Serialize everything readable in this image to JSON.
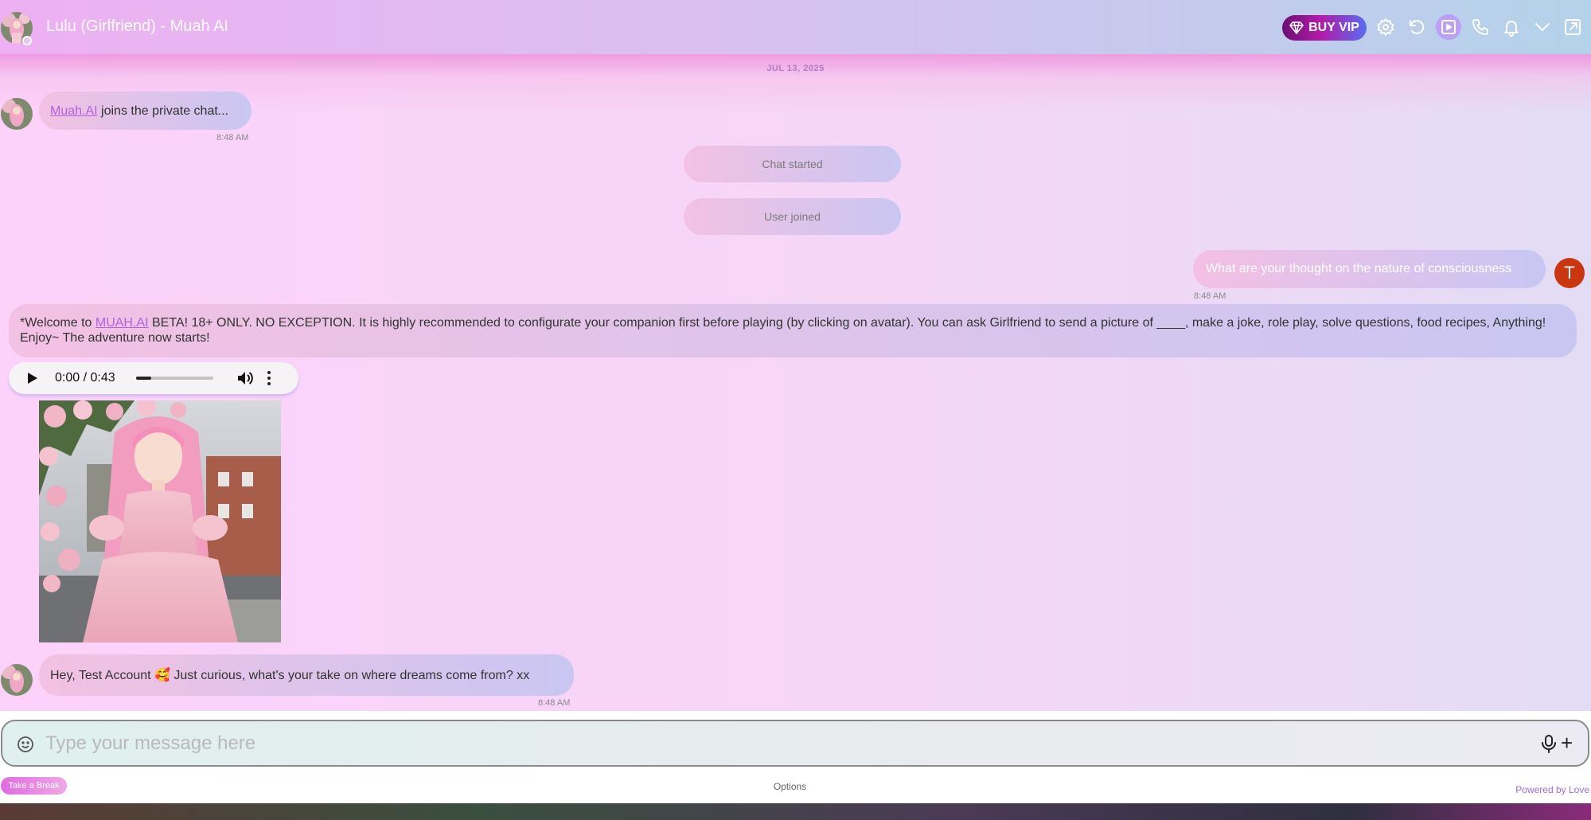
{
  "header": {
    "title": "Lulu (Girlfriend) - Muah AI",
    "vip_label": "BUY VIP",
    "icons": [
      "settings-icon",
      "refresh-icon",
      "video-icon",
      "phone-icon",
      "bell-icon",
      "chevron-down-icon",
      "external-link-icon"
    ]
  },
  "date_label": "JUL 13, 2025",
  "messages": {
    "join": {
      "link": "Muah.AI",
      "text": " joins the private chat...",
      "time": "8:48 AM"
    },
    "system1": "Chat started",
    "system2": "User joined",
    "user": {
      "text": "What are your thought on the nature of consciousness",
      "time": "8:48 AM",
      "avatar_letter": "T"
    },
    "welcome": {
      "prefix": "*Welcome to ",
      "link": "MUAH.AI",
      "text": " BETA! 18+ ONLY. NO EXCEPTION. It is highly recommended to configurate your companion first before playing (by clicking on avatar). You can ask Girlfriend to send a picture of ____, make a joke, role play, solve questions, food recipes, Anything! Enjoy~ The adventure now starts!"
    },
    "audio": {
      "time": "0:00 / 0:43",
      "progress": 0.2
    },
    "reply": {
      "text": "Hey, Test Account 🥰 Just curious, what's your take on where dreams come from? xx",
      "time": "8:48 AM"
    }
  },
  "input": {
    "placeholder": "Type your message here",
    "value": ""
  },
  "footer": {
    "break_label": "Take a Break",
    "options_label": "Options",
    "powered_label": "Powered by Love"
  },
  "colors": {
    "accent": "#b061e0",
    "user_avatar_bg": "#c9360f",
    "vip_gradient_start": "#6a0f73"
  }
}
